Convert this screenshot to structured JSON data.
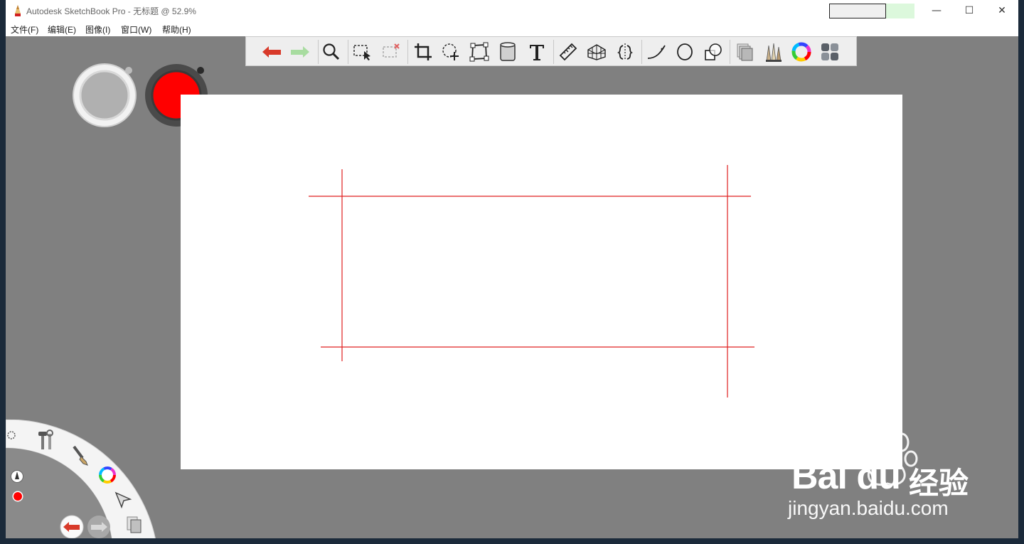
{
  "window": {
    "title": "Autodesk SketchBook Pro - 无标题 @ 52.9%",
    "controls": {
      "minimize": "—",
      "maximize": "☐",
      "close": "✕"
    }
  },
  "menu": [
    {
      "label": "文件(F)"
    },
    {
      "label": "编辑(E)"
    },
    {
      "label": "图像(I)"
    },
    {
      "label": "窗口(W)"
    },
    {
      "label": "帮助(H)"
    }
  ],
  "toolbar": {
    "tools": [
      "undo-icon",
      "redo-icon",
      "zoom-icon",
      "select-icon",
      "deselect-icon",
      "crop-icon",
      "transform-icon",
      "distort-icon",
      "fill-icon",
      "text-icon",
      "ruler-icon",
      "perspective-icon",
      "symmetry-icon",
      "curve-icon",
      "ellipse-icon",
      "shapes-icon",
      "layers-icon",
      "brushes-icon",
      "color-wheel-icon",
      "palettes-icon"
    ]
  },
  "colors": {
    "brush_color": "#ff0000",
    "secondary_color": "#b0b0b0",
    "workspace": "#808080",
    "canvas": "#ffffff",
    "stroke": "#e02020"
  },
  "watermark": {
    "brand": "Bai du",
    "cn": "经验",
    "url": "jingyan.baidu.com"
  }
}
